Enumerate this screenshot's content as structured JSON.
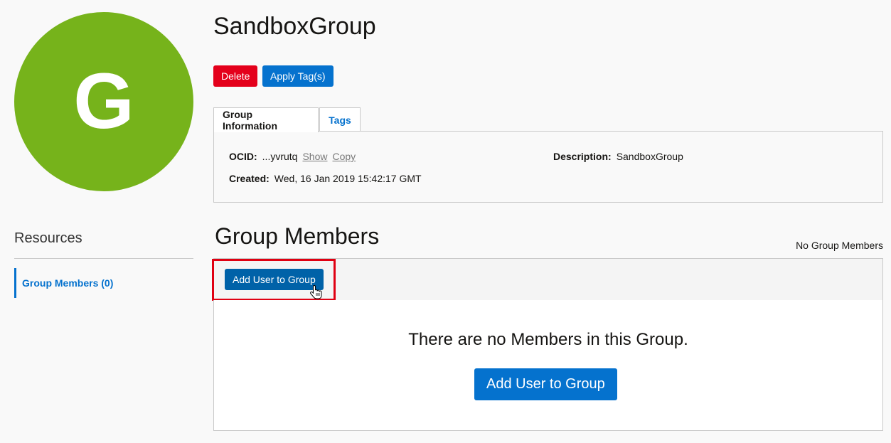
{
  "colors": {
    "avatar_bg": "#76b31b",
    "delete_btn": "#e4001b",
    "primary_btn": "#0572ce",
    "toolbar_btn": "#0062a8",
    "link": "#0572ce",
    "highlight": "#e00012"
  },
  "avatar": {
    "letter": "G"
  },
  "header": {
    "title": "SandboxGroup",
    "delete_label": "Delete",
    "apply_tags_label": "Apply Tag(s)"
  },
  "tabs": [
    {
      "label": "Group Information",
      "active": true
    },
    {
      "label": "Tags",
      "active": false
    }
  ],
  "info": {
    "ocid_label": "OCID:",
    "ocid_value": "...yvrutq",
    "show_label": "Show",
    "copy_label": "Copy",
    "created_label": "Created:",
    "created_value": "Wed, 16 Jan 2019 15:42:17 GMT",
    "description_label": "Description:",
    "description_value": "SandboxGroup"
  },
  "sidebar": {
    "title": "Resources",
    "items": [
      {
        "label": "Group Members (0)"
      }
    ]
  },
  "members": {
    "title": "Group Members",
    "count_text": "No Group Members",
    "add_button_label": "Add User to Group",
    "empty_message": "There are no Members in this Group.",
    "empty_add_button_label": "Add User to Group"
  },
  "icons": {
    "cursor": "hand-pointer-icon"
  }
}
